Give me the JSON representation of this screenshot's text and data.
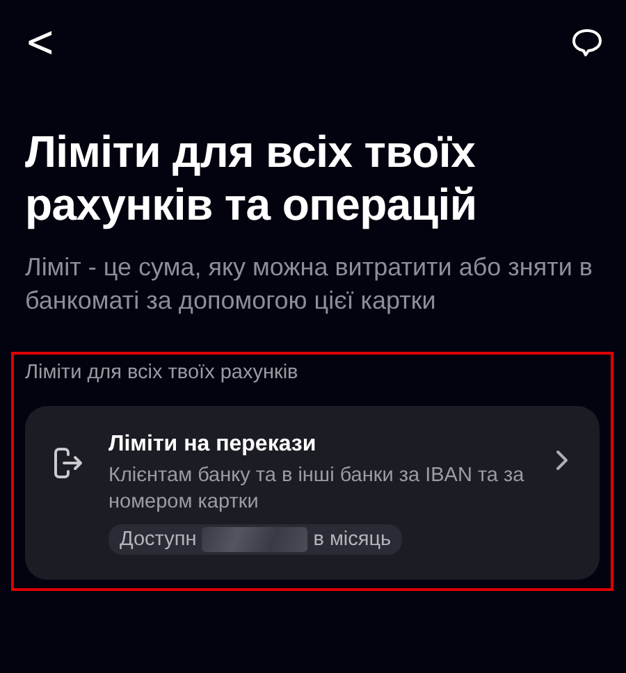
{
  "header": {
    "back": "<"
  },
  "title": "Ліміти для всіх твоїх рахунків та операцій",
  "subtitle": "Ліміт - це сума, яку можна витратити або зняти в банкоматі за допомогою цієї картки",
  "section": {
    "label": "Ліміти для всіх твоїх рахунків",
    "items": [
      {
        "title": "Ліміти на перекази",
        "description": "Клієнтам банку та в інші банки за IBAN та за номером картки",
        "badge_start": "Доступн",
        "badge_end": "в місяць"
      }
    ]
  }
}
